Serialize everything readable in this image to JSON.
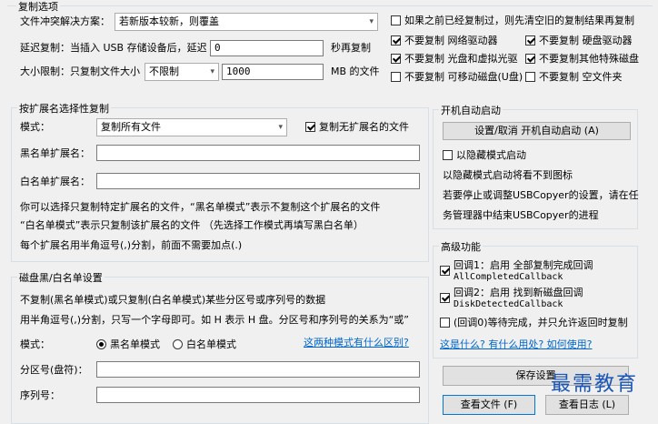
{
  "copy_options": {
    "legend": "复制选项",
    "conflict_label": "文件冲突解决方案：",
    "conflict_value": "若新版本较新，则覆盖",
    "delay_label": "延迟复制：当插入 USB 存储设备后，延迟",
    "delay_value": "0",
    "delay_unit": "秒再复制",
    "size_label": "大小限制：只复制文件大小",
    "size_mode": "不限制",
    "size_value": "1000",
    "size_unit": "MB 的文件",
    "checks": [
      {
        "label": "如果之前已经复制过，则先清空旧的复制结果再复制",
        "checked": false
      },
      {
        "label": "不要复制 网络驱动器",
        "checked": true
      },
      {
        "label": "不要复制 硬盘驱动器",
        "checked": true
      },
      {
        "label": "不要复制 光盘和虚拟光驱",
        "checked": true
      },
      {
        "label": "不要复制其他特殊磁盘",
        "checked": true
      },
      {
        "label": "不要复制 可移动磁盘(U盘)",
        "checked": false
      },
      {
        "label": "不要复制 空文件夹",
        "checked": false
      }
    ]
  },
  "ext_filter": {
    "legend": "按扩展名选择性复制",
    "mode_label": "模式：",
    "mode_value": "复制所有文件",
    "copy_noext_label": "复制无扩展名的文件",
    "copy_noext_checked": true,
    "blacklist_label": "黑名单扩展名：",
    "blacklist_value": "",
    "whitelist_label": "白名单扩展名：",
    "whitelist_value": "",
    "desc1": "你可以选择只复制特定扩展名的文件，“黑名单模式”表示不复制这个扩展名的文件",
    "desc2": "“白名单模式”表示只复制该扩展名的文件  （先选择工作模式再填写黑白名单）",
    "desc3": "每个扩展名用半角逗号(,)分割，前面不需要加点(.)"
  },
  "disk_filter": {
    "legend": "磁盘黑/白名单设置",
    "desc1": "不复制(黑名单模式)或只复制(白名单模式)某些分区号或序列号的数据",
    "desc2": "用半角逗号(,)分割，只写一个字母即可。如 H 表示 H 盘。分区号和序列号的关系为“或”",
    "mode_label": "模式：",
    "radio_black": "黑名单模式",
    "radio_white": "白名单模式",
    "selected": "black",
    "diff_link": "这两种模式有什么区别?",
    "partition_label": "分区号(盘符)：",
    "partition_value": "",
    "serial_label": "序列号：",
    "serial_value": ""
  },
  "autostart": {
    "legend": "开机自动启动",
    "button_label": "设置/取消 开机自动启动 (A)",
    "hidden_label": "以隐藏模式启动",
    "hidden_checked": false,
    "info1": "以隐藏模式启动将看不到图标",
    "info2": "若要停止或调整USBCopyer的设置，请在任",
    "info3": "务管理器中结束USBCopyer的进程"
  },
  "advanced": {
    "legend": "高级功能",
    "cb1_label": "回调1：启用 全部复制完成回调",
    "cb1_sub": "AllCompletedCallback",
    "cb1_checked": true,
    "cb2_label": "回调2：启用 找到新磁盘回调",
    "cb2_sub": "DiskDetectedCallback",
    "cb2_checked": true,
    "cb3_label": "(回调0)等待完成，并只允许返回时复制",
    "cb3_checked": false,
    "help_link": "这是什么? 有什么用处? 如何使用?"
  },
  "buttons": {
    "save": "保存设置",
    "view_files": "查看文件 (F)",
    "view_log": "查看日志 (L)"
  },
  "watermark": "最需教育"
}
